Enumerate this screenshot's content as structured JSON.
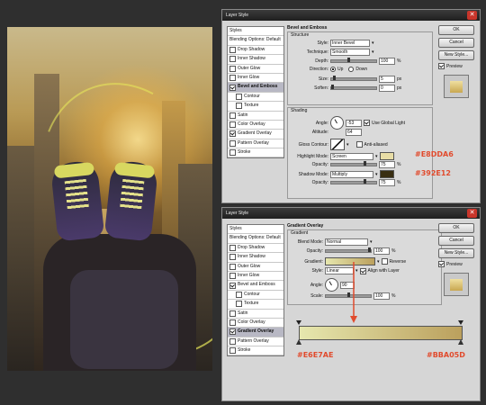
{
  "colors": {
    "highlight_hex": "#E8DDA6",
    "shadow_hex": "#392E12",
    "grad_start_hex": "#E6E7AE",
    "grad_end_hex": "#BBA05D",
    "annotation": "#E14B2D"
  },
  "top_dialog": {
    "title": "Layer Style",
    "styles_list": [
      {
        "label": "Styles",
        "checkbox": false,
        "checked": false
      },
      {
        "label": "Blending Options: Default",
        "checkbox": false,
        "checked": false
      },
      {
        "label": "Drop Shadow",
        "checkbox": true,
        "checked": false
      },
      {
        "label": "Inner Shadow",
        "checkbox": true,
        "checked": false
      },
      {
        "label": "Outer Glow",
        "checkbox": true,
        "checked": false
      },
      {
        "label": "Inner Glow",
        "checkbox": true,
        "checked": false
      },
      {
        "label": "Bevel and Emboss",
        "checkbox": true,
        "checked": true,
        "selected": true
      },
      {
        "label": "Contour",
        "checkbox": true,
        "checked": false,
        "indent": true
      },
      {
        "label": "Texture",
        "checkbox": true,
        "checked": false,
        "indent": true
      },
      {
        "label": "Satin",
        "checkbox": true,
        "checked": false
      },
      {
        "label": "Color Overlay",
        "checkbox": true,
        "checked": false
      },
      {
        "label": "Gradient Overlay",
        "checkbox": true,
        "checked": true
      },
      {
        "label": "Pattern Overlay",
        "checkbox": true,
        "checked": false
      },
      {
        "label": "Stroke",
        "checkbox": true,
        "checked": false
      }
    ],
    "section_title": "Bevel and Emboss",
    "structure_title": "Structure",
    "style_label": "Style:",
    "style_value": "Inner Bevel",
    "technique_label": "Technique:",
    "technique_value": "Smooth",
    "depth_label": "Depth:",
    "depth_value": "100",
    "depth_unit": "%",
    "direction_label": "Direction:",
    "direction_up": "Up",
    "direction_down": "Down",
    "size_label": "Size:",
    "size_value": "5",
    "size_unit": "px",
    "soften_label": "Soften:",
    "soften_value": "0",
    "soften_unit": "px",
    "shading_title": "Shading",
    "angle_label": "Angle:",
    "angle_value": "-53",
    "global_light": "Use Global Light",
    "altitude_label": "Altitude:",
    "altitude_value": "64",
    "gloss_label": "Gloss Contour:",
    "anti_aliased": "Anti-aliased",
    "highlight_label": "Highlight Mode:",
    "highlight_value": "Screen",
    "opacity_label": "Opacity:",
    "hl_opacity": "75",
    "pct": "%",
    "shadow_label": "Shadow Mode:",
    "shadow_value": "Multiply",
    "sh_opacity": "75",
    "buttons": {
      "ok": "OK",
      "cancel": "Cancel",
      "new_style": "New Style...",
      "preview": "Preview"
    }
  },
  "bottom_dialog": {
    "title": "Layer Style",
    "styles_list": [
      {
        "label": "Styles",
        "checkbox": false,
        "checked": false
      },
      {
        "label": "Blending Options: Default",
        "checkbox": false,
        "checked": false
      },
      {
        "label": "Drop Shadow",
        "checkbox": true,
        "checked": false
      },
      {
        "label": "Inner Shadow",
        "checkbox": true,
        "checked": false
      },
      {
        "label": "Outer Glow",
        "checkbox": true,
        "checked": false
      },
      {
        "label": "Inner Glow",
        "checkbox": true,
        "checked": false
      },
      {
        "label": "Bevel and Emboss",
        "checkbox": true,
        "checked": true
      },
      {
        "label": "Contour",
        "checkbox": true,
        "checked": false,
        "indent": true
      },
      {
        "label": "Texture",
        "checkbox": true,
        "checked": false,
        "indent": true
      },
      {
        "label": "Satin",
        "checkbox": true,
        "checked": false
      },
      {
        "label": "Color Overlay",
        "checkbox": true,
        "checked": false
      },
      {
        "label": "Gradient Overlay",
        "checkbox": true,
        "checked": true,
        "selected": true
      },
      {
        "label": "Pattern Overlay",
        "checkbox": true,
        "checked": false
      },
      {
        "label": "Stroke",
        "checkbox": true,
        "checked": false
      }
    ],
    "section_title": "Gradient Overlay",
    "gradient_title": "Gradient",
    "blend_label": "Blend Mode:",
    "blend_value": "Normal",
    "opacity_label": "Opacity:",
    "opacity_value": "100",
    "pct": "%",
    "gradient_label": "Gradient:",
    "reverse": "Reverse",
    "style_label": "Style:",
    "style_value": "Linear",
    "align_layer": "Align with Layer",
    "angle_label": "Angle:",
    "angle_value": "90",
    "scale_label": "Scale:",
    "scale_value": "100",
    "buttons": {
      "ok": "OK",
      "cancel": "Cancel",
      "new_style": "New Style...",
      "preview": "Preview"
    }
  }
}
